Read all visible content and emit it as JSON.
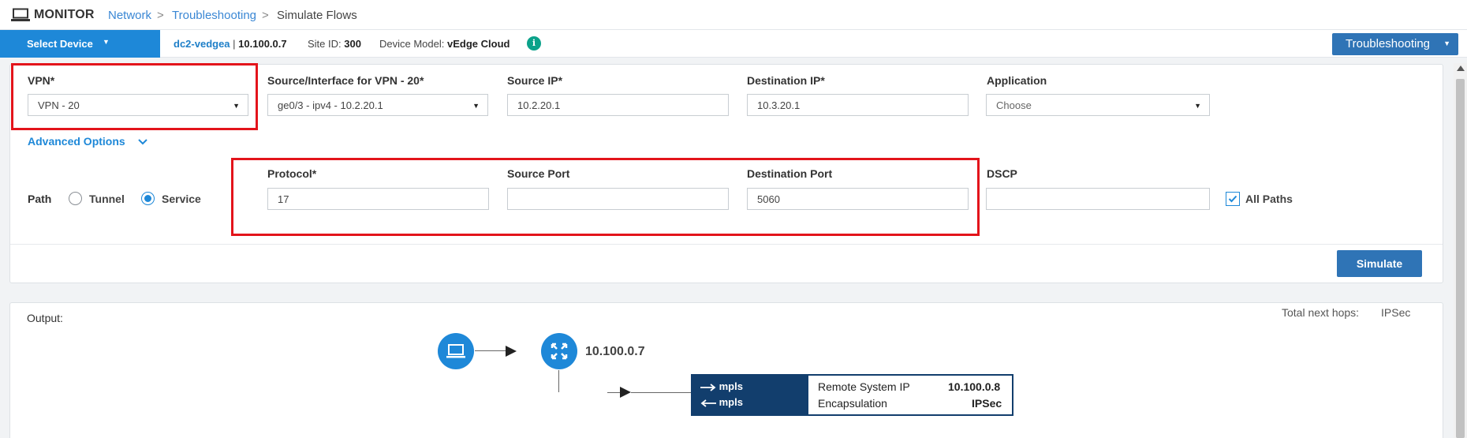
{
  "header": {
    "title": "MONITOR",
    "breadcrumbs": [
      {
        "label": "Network"
      },
      {
        "label": "Troubleshooting"
      },
      {
        "label": "Simulate Flows"
      }
    ],
    "separator": ">"
  },
  "device_bar": {
    "select_device_label": "Select Device",
    "device_name": "dc2-vedgea",
    "device_ip_sep": " | ",
    "device_ip": "10.100.0.7",
    "site_id_label": "Site ID:",
    "site_id": "300",
    "model_label": "Device Model:",
    "model": "vEdge Cloud",
    "info_icon": "i",
    "troubleshooting_label": "Troubleshooting"
  },
  "form": {
    "vpn": {
      "label": "VPN*",
      "value": "VPN - 20"
    },
    "source_interface": {
      "label": "Source/Interface for VPN - 20*",
      "value": "ge0/3 - ipv4 - 10.2.20.1"
    },
    "source_ip": {
      "label": "Source IP*",
      "value": "10.2.20.1"
    },
    "destination_ip": {
      "label": "Destination IP*",
      "value": "10.3.20.1"
    },
    "application": {
      "label": "Application",
      "placeholder": "Choose"
    },
    "advanced_options_label": "Advanced Options",
    "path": {
      "label": "Path",
      "options": [
        "Tunnel",
        "Service"
      ],
      "selected": "Service"
    },
    "protocol": {
      "label": "Protocol*",
      "value": "17"
    },
    "source_port": {
      "label": "Source Port",
      "value": ""
    },
    "destination_port": {
      "label": "Destination Port",
      "value": "5060"
    },
    "dscp": {
      "label": "DSCP",
      "value": ""
    },
    "all_paths": {
      "label": "All Paths",
      "checked": true
    },
    "simulate_label": "Simulate"
  },
  "output": {
    "label": "Output:",
    "total_next_hops_label": "Total next hops:",
    "total_next_hops_value": "IPSec",
    "router_ip": "10.100.0.7",
    "tunnel": {
      "out_color": "mpls",
      "in_color": "mpls",
      "remote_system_ip_label": "Remote System IP",
      "remote_system_ip": "10.100.0.8",
      "encapsulation_label": "Encapsulation",
      "encapsulation": "IPSec"
    }
  },
  "colors": {
    "primary": "#1e88d8",
    "button": "#2f74b6",
    "tunnel_bg": "#123e6d",
    "highlight_box": "#e3141b",
    "info": "#0ba28a"
  }
}
